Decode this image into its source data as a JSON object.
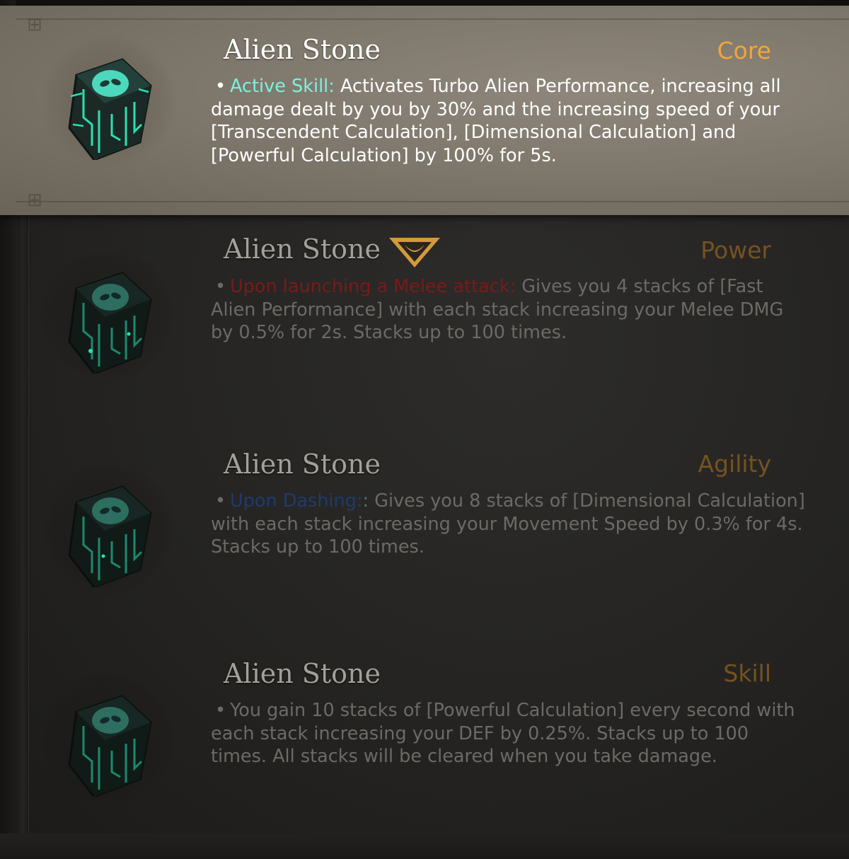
{
  "cards": [
    {
      "title": "Alien Stone",
      "category": "Core",
      "state": "selected",
      "keyword": "Active Skill:",
      "keyword_color": "#7ff0e0",
      "text": "Activates Turbo Alien Performance, increasing all damage dealt by you by 30% and the increasing speed of your [Transcendent Calculation], [Dimensional Calculation] and [Powerful Calculation] by 100% for 5s."
    },
    {
      "title": "Alien Stone",
      "category": "Power",
      "state": "dim",
      "badge": "v-emblem-icon",
      "keyword": "Upon launching a Melee attack:",
      "keyword_color": "#7a1a1a",
      "text": "Gives you 4 stacks of [Fast Alien Performance] with each stack increasing your Melee DMG by 0.5% for 2s. Stacks up to 100 times."
    },
    {
      "title": "Alien Stone",
      "category": "Agility",
      "state": "dim",
      "keyword": "Upon Dashing:",
      "keyword_color": "#1f3a6e",
      "text": ": Gives you 8 stacks of [Dimensional Calculation] with each stack increasing your Movement Speed by 0.3% for 4s. Stacks up to 100 times."
    },
    {
      "title": "Alien Stone",
      "category": "Skill",
      "state": "dim",
      "keyword": "",
      "keyword_color": "",
      "text": "You gain 10 stacks of [Powerful Calculation] every second with each stack increasing your DEF by 0.25%. Stacks up to 100 times. All stacks will be cleared when you take damage."
    }
  ],
  "bullet": "•",
  "icon_name": "alien-stone-cube-icon",
  "colors": {
    "selected_bg": "#7b7468",
    "dim_bg": "#242321",
    "core_label": "#f0a63a",
    "glow": "#2be0b0"
  }
}
